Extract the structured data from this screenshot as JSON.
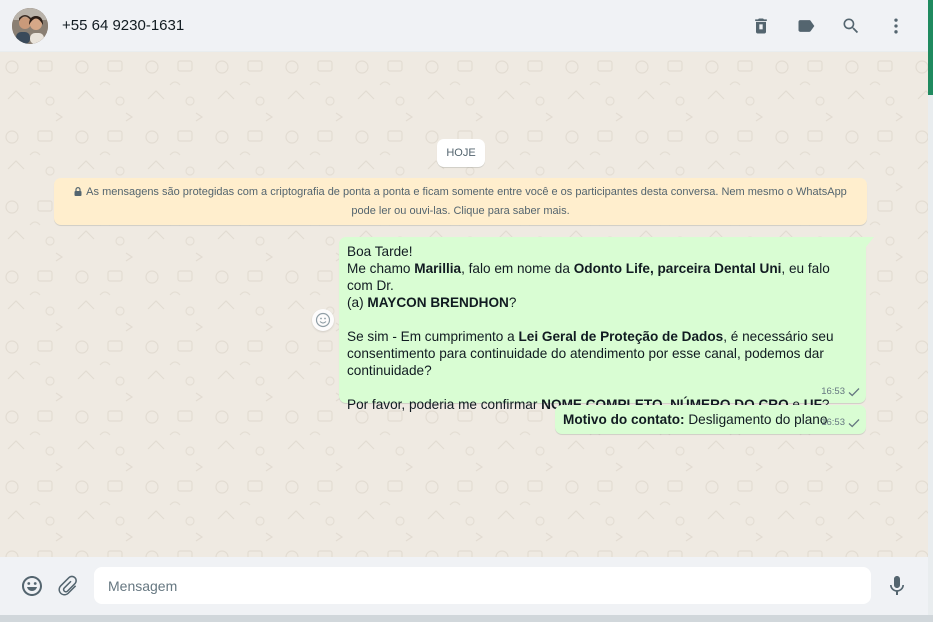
{
  "header": {
    "contact_name": "+55 64 9230-1631",
    "icons": [
      "delete-icon",
      "label-icon",
      "search-icon",
      "menu-icon"
    ]
  },
  "chat": {
    "date_chip": "HOJE",
    "encryption_notice": "As mensagens são protegidas com a criptografia de ponta a ponta e ficam somente entre você e os participantes desta conversa. Nem mesmo o WhatsApp pode ler ou ouvi-las. Clique para saber mais.",
    "messages": [
      {
        "direction": "outgoing",
        "time": "16:53",
        "status": "sent",
        "greeting": "Boa Tarde!",
        "line2": {
          "t1": "Me chamo ",
          "b1": "Marillia",
          "t2": ", falo em nome da ",
          "b2": "Odonto Life, parceira Dental Uni",
          "t3": ", eu falo com Dr.",
          "t4": "(a) ",
          "b3": "MAYCON BRENDHON",
          "t5": "?"
        },
        "para2": {
          "t1": "Se sim - Em cumprimento a ",
          "b1": "Lei Geral de Proteção de Dados",
          "t2": ", é necessário seu",
          "t3": "consentimento para continuidade do atendimento por esse canal, podemos dar",
          "t4": "continuidade?"
        },
        "para3": {
          "t1": "Por favor, poderia me confirmar ",
          "b1": "NOME COMPLETO",
          "t2": ", ",
          "b2": "NÚMERO DO CRO",
          "t3": " e ",
          "b3": "UF",
          "t4": "?"
        }
      },
      {
        "direction": "outgoing",
        "time": "16:53",
        "status": "sent",
        "label": "Motivo do contato:",
        "text": " Desligamento do plano"
      }
    ]
  },
  "footer": {
    "placeholder": "Mensagem",
    "icons": [
      "emoji-icon",
      "attach-icon",
      "microphone-icon"
    ]
  },
  "colors": {
    "outgoing_bubble": "#d9fdd3",
    "encryption_bg": "#ffeecd",
    "chat_bg": "#efeae2",
    "header_bg": "#f0f2f5",
    "accent": "#1f8a5f"
  }
}
